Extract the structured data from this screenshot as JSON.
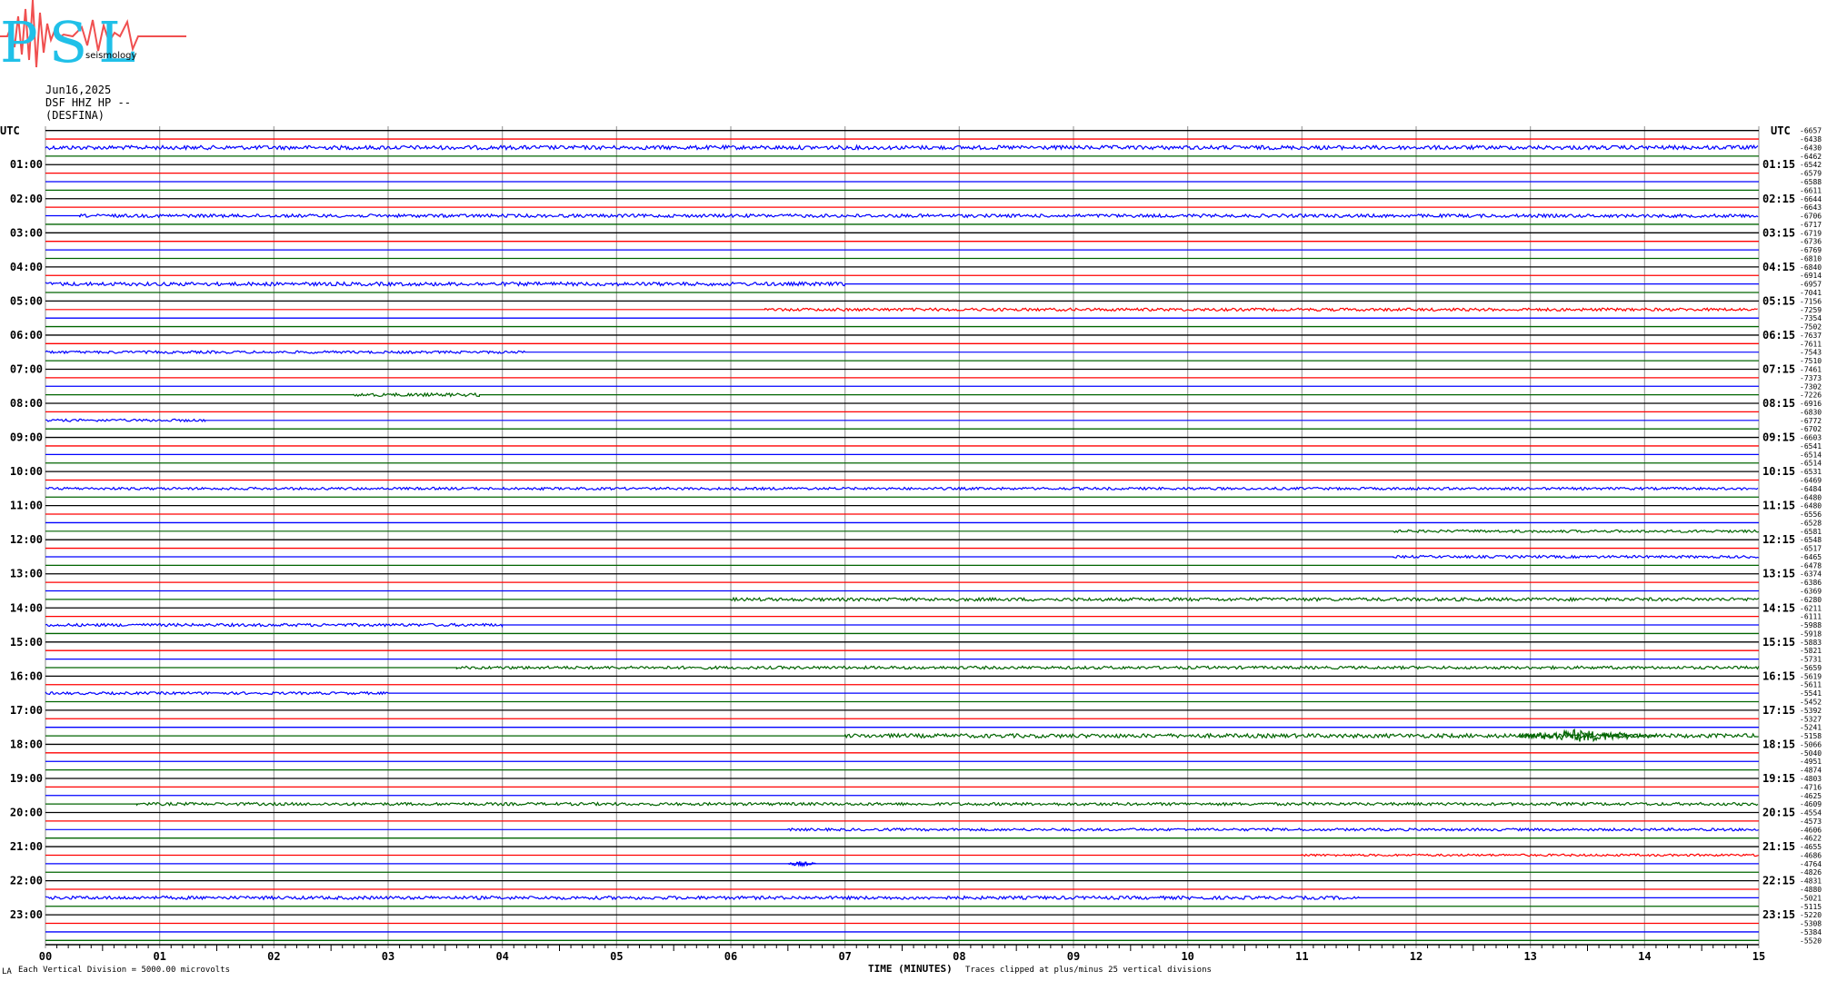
{
  "logo": {
    "text": "PSL",
    "subtitle": "seismology",
    "accent": "#f05050",
    "brand": "#20c0e8"
  },
  "header": {
    "date": "Jun16,2025",
    "station": "DSF HHZ HP --",
    "location": "(DESFINA)"
  },
  "colors": {
    "black": "#000000",
    "red": "#ff0000",
    "blue": "#0000ff",
    "green": "#006400",
    "grid": "#a0a0a0"
  },
  "chart_data": {
    "type": "line",
    "title": "",
    "xlabel": "TIME (MINUTES)",
    "ylabel": "",
    "xlim": [
      0,
      15
    ],
    "x_ticks": [
      "00",
      "01",
      "02",
      "03",
      "04",
      "05",
      "06",
      "07",
      "08",
      "09",
      "10",
      "11",
      "12",
      "13",
      "14",
      "15"
    ],
    "left_axis_title": "UTC",
    "right_axis_title": "UTC",
    "left_time_labels": [
      "01:00",
      "02:00",
      "03:00",
      "04:00",
      "05:00",
      "06:00",
      "07:00",
      "08:00",
      "09:00",
      "10:00",
      "11:00",
      "12:00",
      "13:00",
      "14:00",
      "15:00",
      "16:00",
      "17:00",
      "18:00",
      "19:00",
      "20:00",
      "21:00",
      "22:00",
      "23:00"
    ],
    "right_time_labels": [
      "01:15",
      "02:15",
      "03:15",
      "04:15",
      "05:15",
      "06:15",
      "07:15",
      "08:15",
      "09:15",
      "10:15",
      "11:15",
      "12:15",
      "13:15",
      "14:15",
      "15:15",
      "16:15",
      "17:15",
      "18:15",
      "19:15",
      "20:15",
      "21:15",
      "22:15",
      "23:15"
    ],
    "trace_color_cycle": [
      "black",
      "red",
      "blue",
      "green"
    ],
    "trace_count": 96,
    "trace_offsets": [
      "-6657",
      "-6438",
      "-6430",
      "-6462",
      "-6542",
      "-6579",
      "-6588",
      "-6611",
      "-6644",
      "-6643",
      "-6706",
      "-6717",
      "-6719",
      "-6736",
      "-6769",
      "-6810",
      "-6840",
      "-6914",
      "-6957",
      "-7041",
      "-7156",
      "-7259",
      "-7354",
      "-7502",
      "-7637",
      "-7611",
      "-7543",
      "-7510",
      "-7461",
      "-7373",
      "-7302",
      "-7226",
      "-6916",
      "-6830",
      "-6772",
      "-6702",
      "-6603",
      "-6541",
      "-6514",
      "-6514",
      "-6531",
      "-6469",
      "-6484",
      "-6480",
      "-6480",
      "-6556",
      "-6528",
      "-6581",
      "-6548",
      "-6517",
      "-6465",
      "-6478",
      "-6374",
      "-6386",
      "-6369",
      "-6280",
      "-6211",
      "-6111",
      "-5988",
      "-5918",
      "-5883",
      "-5821",
      "-5731",
      "-5659",
      "-5619",
      "-5611",
      "-5541",
      "-5452",
      "-5392",
      "-5327",
      "-5241",
      "-5158",
      "-5066",
      "-5040",
      "-4951",
      "-4874",
      "-4803",
      "-4716",
      "-4625",
      "-4609",
      "-4554",
      "-4573",
      "-4606",
      "-4622",
      "-4655",
      "-4686",
      "-4764",
      "-4826",
      "-4831",
      "-4880",
      "-5021",
      "-5115",
      "-5220",
      "-5308",
      "-5384",
      "-5520"
    ],
    "active_traces": [
      {
        "row": 2,
        "amplitude": 2.2,
        "from_min": 0,
        "to_min": 15
      },
      {
        "row": 10,
        "amplitude": 1.8,
        "from_min": 0.3,
        "to_min": 15
      },
      {
        "row": 18,
        "amplitude": 2.0,
        "from_min": 0,
        "to_min": 7
      },
      {
        "row": 21,
        "amplitude": 1.6,
        "from_min": 6.3,
        "to_min": 15
      },
      {
        "row": 26,
        "amplitude": 1.4,
        "from_min": 0,
        "to_min": 4.2
      },
      {
        "row": 31,
        "amplitude": 1.8,
        "from_min": 2.7,
        "to_min": 3.8
      },
      {
        "row": 34,
        "amplitude": 1.4,
        "from_min": 0,
        "to_min": 1.4
      },
      {
        "row": 42,
        "amplitude": 1.4,
        "from_min": 0,
        "to_min": 15
      },
      {
        "row": 47,
        "amplitude": 1.4,
        "from_min": 11.8,
        "to_min": 15
      },
      {
        "row": 50,
        "amplitude": 1.4,
        "from_min": 11.8,
        "to_min": 15
      },
      {
        "row": 55,
        "amplitude": 1.8,
        "from_min": 6.0,
        "to_min": 15
      },
      {
        "row": 58,
        "amplitude": 1.6,
        "from_min": 0,
        "to_min": 4.0
      },
      {
        "row": 63,
        "amplitude": 1.6,
        "from_min": 3.6,
        "to_min": 15
      },
      {
        "row": 66,
        "amplitude": 1.4,
        "from_min": 0,
        "to_min": 3.0
      },
      {
        "row": 71,
        "amplitude": 2.2,
        "from_min": 7.0,
        "to_min": 15
      },
      {
        "row": 79,
        "amplitude": 1.6,
        "from_min": 0.8,
        "to_min": 15
      },
      {
        "row": 82,
        "amplitude": 1.4,
        "from_min": 6.5,
        "to_min": 15
      },
      {
        "row": 85,
        "amplitude": 1.2,
        "from_min": 11.0,
        "to_min": 15
      },
      {
        "row": 90,
        "amplitude": 1.8,
        "from_min": 0,
        "to_min": 11.5
      }
    ],
    "events": [
      {
        "row": 71,
        "start_min": 12.9,
        "end_min": 14.1,
        "amplitude": 7
      },
      {
        "row": 86,
        "start_min": 6.5,
        "end_min": 6.75,
        "amplitude": 3
      }
    ]
  },
  "footer": {
    "note_left": "Each Vertical Division = 5000.00 microvolts",
    "note_right": "Traces clipped at plus/minus 25 vertical divisions",
    "corner_mark": "LA"
  }
}
